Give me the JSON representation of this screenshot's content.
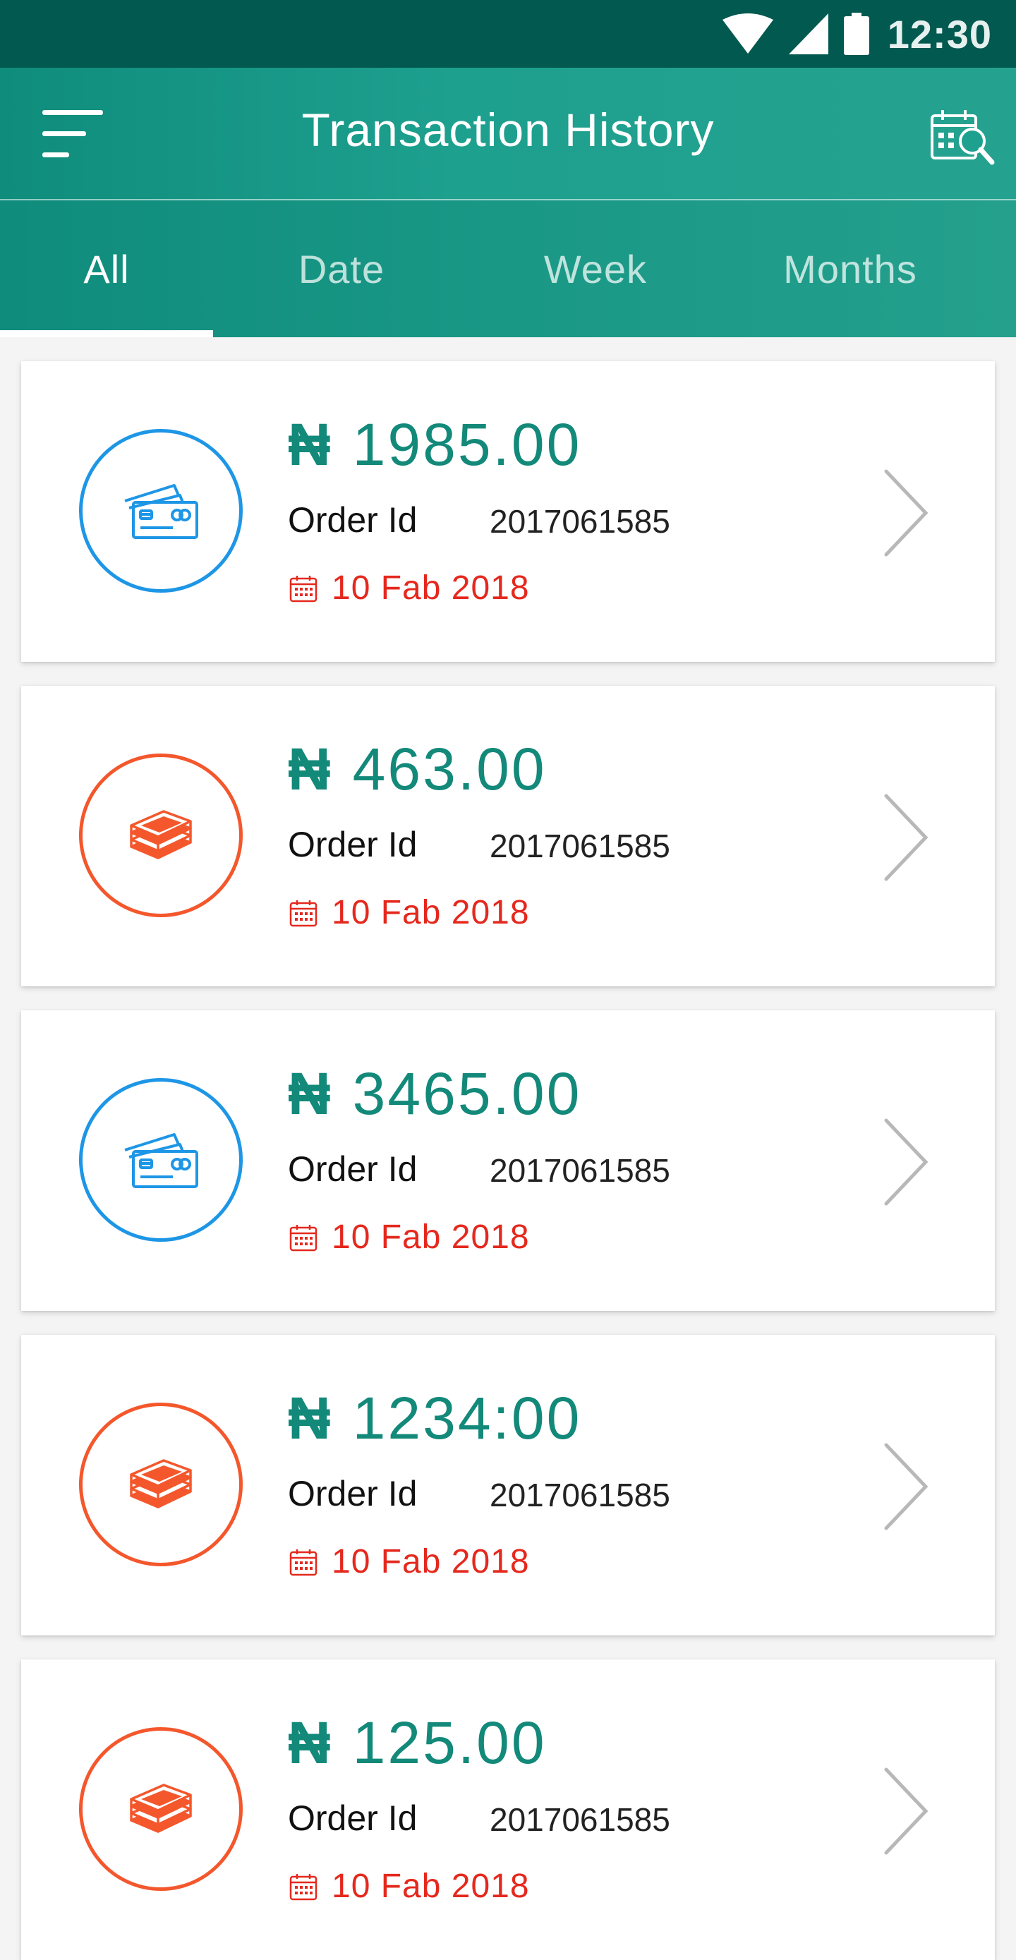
{
  "status_bar": {
    "time": "12:30"
  },
  "app_bar": {
    "title": "Transaction History"
  },
  "tabs": [
    {
      "label": "All",
      "active": true
    },
    {
      "label": "Date",
      "active": false
    },
    {
      "label": "Week",
      "active": false
    },
    {
      "label": "Months",
      "active": false
    }
  ],
  "colors": {
    "primary": "#13897a",
    "status_bar": "#02594f",
    "card_blue": "#1e96e6",
    "card_orange": "#f4572c",
    "date_red": "#e5281d"
  },
  "transactions": [
    {
      "currency": "₦",
      "amount": "1985.00",
      "order_label": "Order Id",
      "order_id": "2017061585",
      "date": "10 Fab 2018",
      "icon": "credit-card-icon",
      "color": "blue"
    },
    {
      "currency": "₦",
      "amount": "463.00",
      "order_label": "Order Id",
      "order_id": "2017061585",
      "date": "10 Fab 2018",
      "icon": "cash-stack-icon",
      "color": "orange"
    },
    {
      "currency": "₦",
      "amount": "3465.00",
      "order_label": "Order Id",
      "order_id": "2017061585",
      "date": "10 Fab 2018",
      "icon": "credit-card-icon",
      "color": "blue"
    },
    {
      "currency": "₦",
      "amount": "1234:00",
      "order_label": "Order Id",
      "order_id": "2017061585",
      "date": "10 Fab 2018",
      "icon": "cash-stack-icon",
      "color": "orange"
    },
    {
      "currency": "₦",
      "amount": "125.00",
      "order_label": "Order Id",
      "order_id": "2017061585",
      "date": "10 Fab 2018",
      "icon": "cash-stack-icon",
      "color": "orange"
    }
  ]
}
